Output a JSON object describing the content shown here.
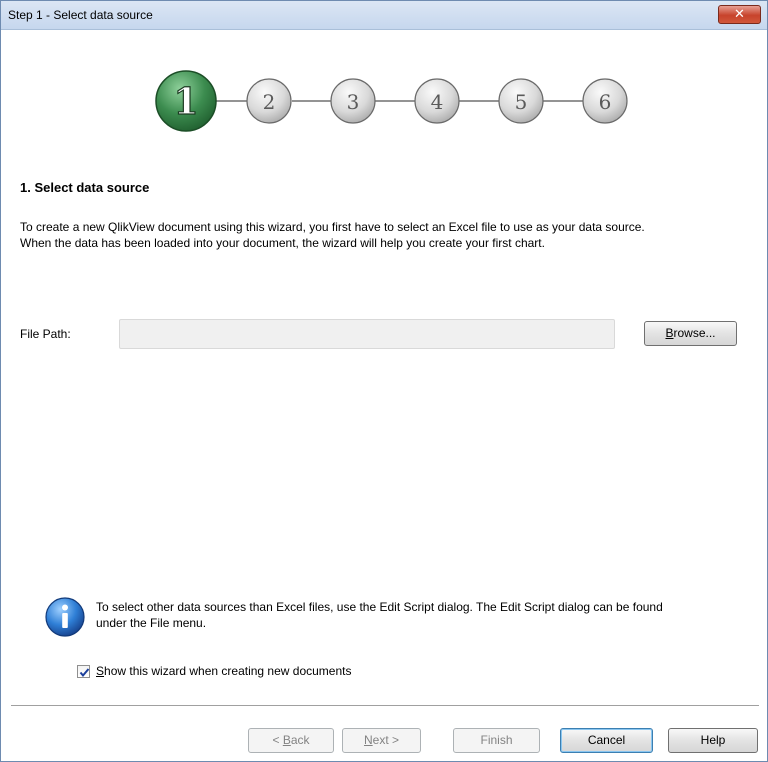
{
  "window": {
    "title": "Step 1 - Select data source",
    "close_glyph": "✕"
  },
  "steps": [
    {
      "label": "1",
      "active": true
    },
    {
      "label": "2",
      "active": false
    },
    {
      "label": "3",
      "active": false
    },
    {
      "label": "4",
      "active": false
    },
    {
      "label": "5",
      "active": false
    },
    {
      "label": "6",
      "active": false
    }
  ],
  "content": {
    "heading": "1. Select data source",
    "description_line1": "To create a new QlikView document using this wizard, you first have to select an Excel file to use as your data source.",
    "description_line2": "When the data has been loaded into your document, the wizard will help you create your first chart.",
    "file_path_label": "File Path:",
    "file_path_value": "",
    "browse_label_first": "B",
    "browse_label_rest": "rowse..."
  },
  "info": {
    "icon": "info-icon",
    "line1": "To select other data sources than Excel files, use the Edit Script dialog. The Edit Script dialog can be found",
    "line2": "under the File menu."
  },
  "options": {
    "show_wizard_checked": true,
    "show_wizard_first": "S",
    "show_wizard_rest": "how this wizard when creating new documents"
  },
  "footer": {
    "back_prefix": "< ",
    "back_accel": "B",
    "back_rest": "ack",
    "next_accel": "N",
    "next_rest": "ext >",
    "finish_label": "Finish",
    "cancel_label": "Cancel",
    "help_label": "Help"
  },
  "colors": {
    "active_step": "#3c8c4f",
    "inactive_step": "#d4d4d4",
    "info_blue": "#2266b8"
  }
}
